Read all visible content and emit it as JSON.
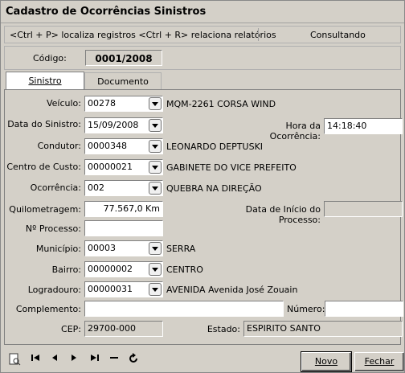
{
  "window": {
    "title": "Cadastro de Ocorrências Sinistros"
  },
  "hints": {
    "text": "<Ctrl + P> localiza registros  <Ctrl + R> relaciona relatórios",
    "mode": "Consultando"
  },
  "codigo": {
    "label": "Código:",
    "value": "0001/2008"
  },
  "tabs": [
    {
      "label": "Sinistro"
    },
    {
      "label": "Documento"
    }
  ],
  "form": {
    "veiculo": {
      "label": "Veículo:",
      "value": "00278",
      "desc": "MQM-2261 CORSA WIND"
    },
    "data_sinistro": {
      "label": "Data do Sinistro:",
      "value": "15/09/2008"
    },
    "hora": {
      "label": "Hora da Ocorrência:",
      "value": "14:18:40"
    },
    "condutor": {
      "label": "Condutor:",
      "value": "0000348",
      "desc": "LEONARDO DEPTUSKI"
    },
    "centro_custo": {
      "label": "Centro de Custo:",
      "value": "00000021",
      "desc": "GABINETE DO VICE PREFEITO"
    },
    "ocorrencia": {
      "label": "Ocorrência:",
      "value": "002",
      "desc": "QUEBRA NA DIREÇÃO"
    },
    "quilometragem": {
      "label": "Quilometragem:",
      "value": "77.567,0 Km"
    },
    "data_inicio": {
      "label": "Data de Início do Processo:",
      "value": ""
    },
    "processo": {
      "label": "Nº Processo:",
      "value": ""
    },
    "municipio": {
      "label": "Município:",
      "value": "00003",
      "desc": "SERRA"
    },
    "bairro": {
      "label": "Bairro:",
      "value": "00000002",
      "desc": "CENTRO"
    },
    "logradouro": {
      "label": "Logradouro:",
      "value": "00000031",
      "desc": "AVENIDA Avenida José Zouain"
    },
    "complemento": {
      "label": "Complemento:",
      "value": ""
    },
    "numero": {
      "label": "Número:",
      "value": ""
    },
    "cep": {
      "label": "CEP:",
      "value": "29700-000"
    },
    "estado": {
      "label": "Estado:",
      "value": "ESPIRITO SANTO"
    }
  },
  "buttons": {
    "novo": "Novo",
    "fechar": "Fechar"
  },
  "toolbar": [
    "print-preview-icon",
    "first-record-icon",
    "prev-record-icon",
    "next-record-icon",
    "last-record-icon",
    "delete-record-icon",
    "refresh-icon"
  ]
}
